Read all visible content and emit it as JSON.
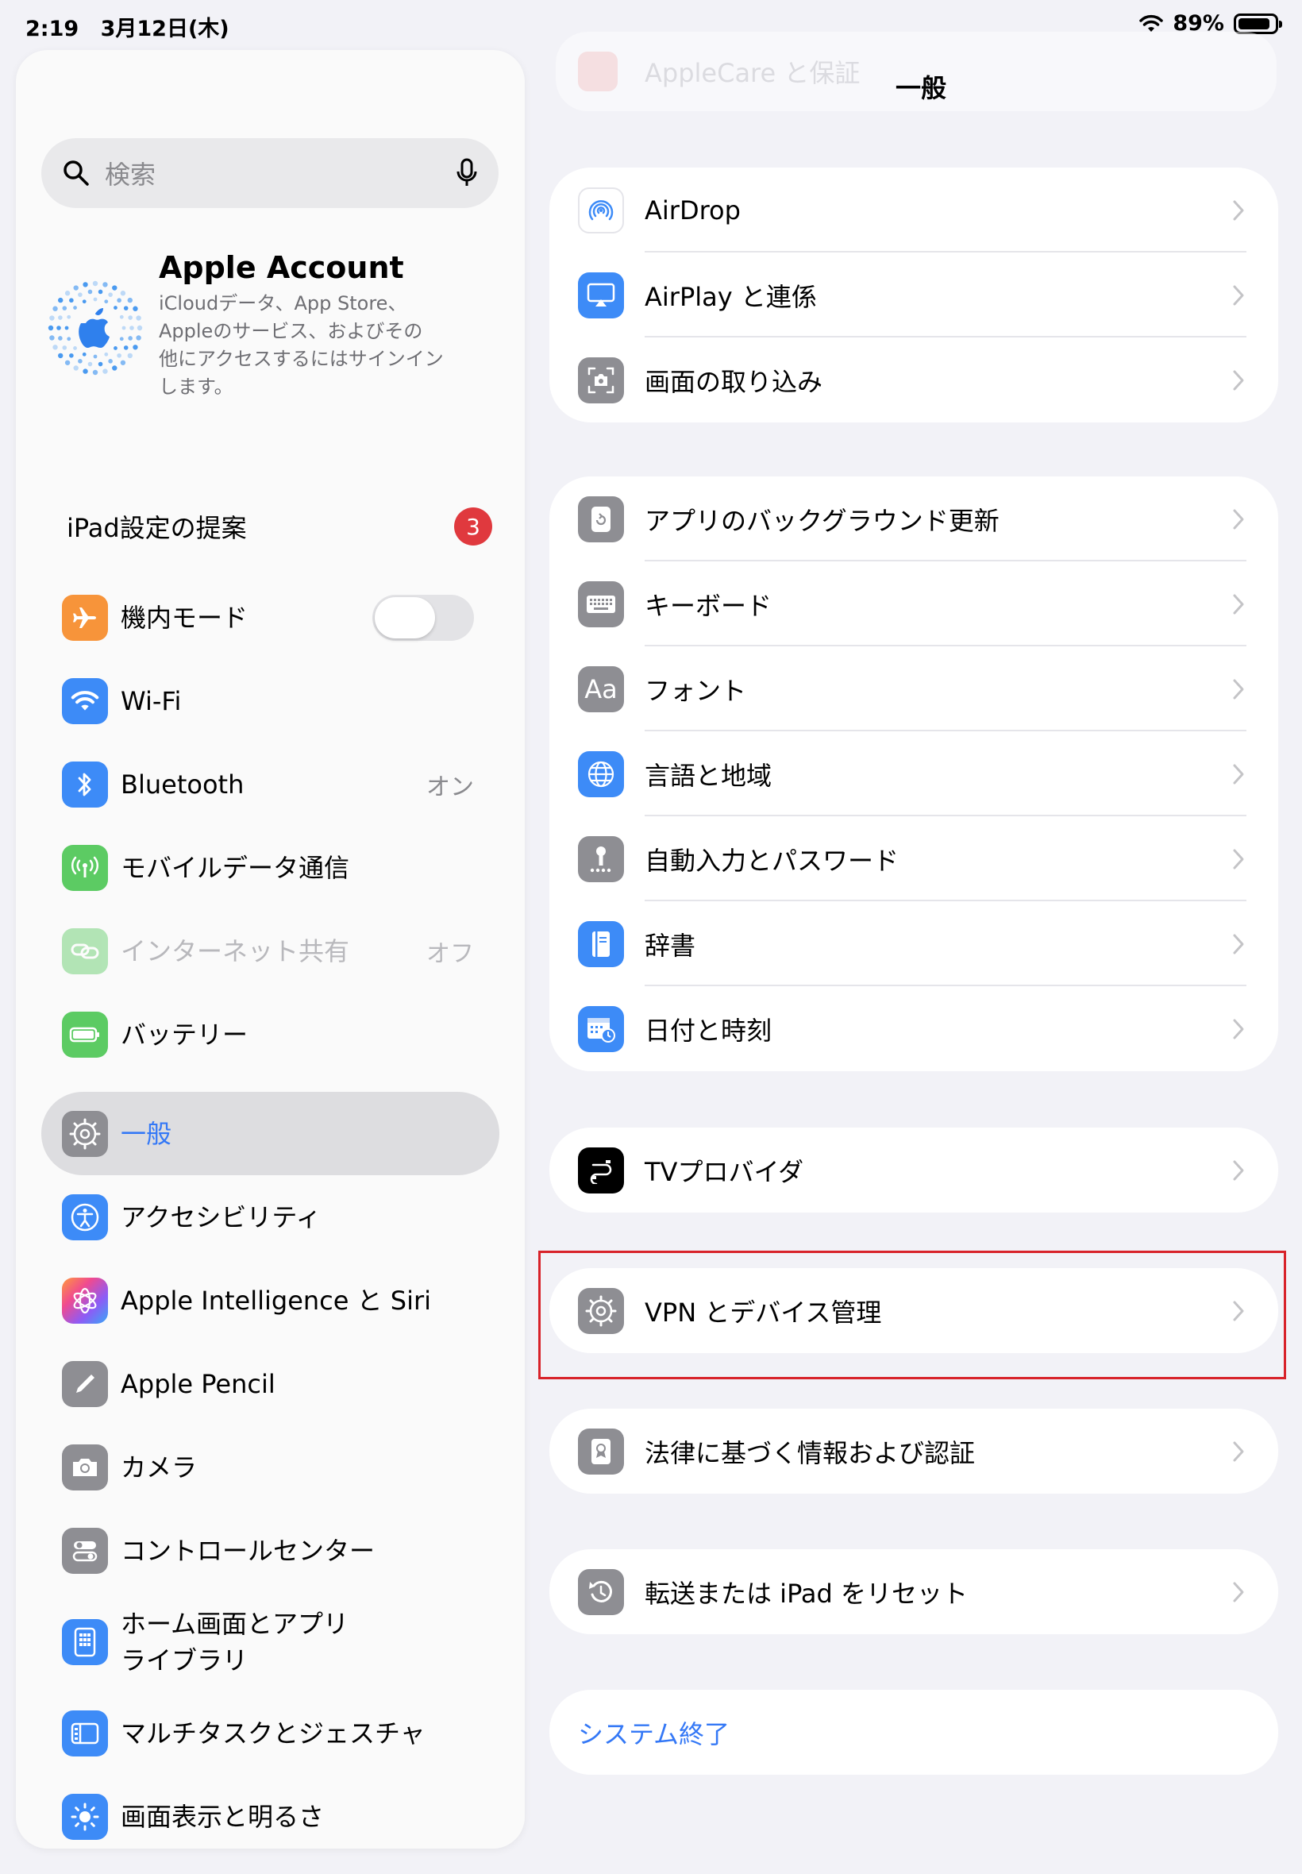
{
  "status_bar": {
    "time": "2:19",
    "date": "3月12日(木)",
    "battery_percent": "89%",
    "battery_level": 0.89
  },
  "sidebar": {
    "search_placeholder": "検索",
    "account": {
      "title": "Apple Account",
      "subtitle_lines": [
        "iCloudデータ、App Store、",
        "Appleのサービス、およびその",
        "他にアクセスするにはサインイン",
        "します。"
      ]
    },
    "suggestions": {
      "label": "iPad設定の提案",
      "badge": "3"
    },
    "items": [
      {
        "label": "機内モード",
        "toggle_on": false
      },
      {
        "label": "Wi-Fi",
        "value": ""
      },
      {
        "label": "Bluetooth",
        "value": "オン"
      },
      {
        "label": "モバイルデータ通信",
        "value": ""
      },
      {
        "label": "インターネット共有",
        "value": "オフ"
      },
      {
        "label": "バッテリー",
        "value": ""
      },
      {
        "label": "一般",
        "selected": true
      },
      {
        "label": "アクセシビリティ"
      },
      {
        "label": "Apple Intelligence と Siri"
      },
      {
        "label": "Apple Pencil"
      },
      {
        "label": "カメラ"
      },
      {
        "label": "コントロールセンター"
      },
      {
        "label_lines": [
          "ホーム画面とアプリ",
          "ライブラリ"
        ]
      },
      {
        "label": "マルチタスクとジェスチャ"
      },
      {
        "label": "画面表示と明るさ"
      }
    ]
  },
  "main": {
    "title": "一般",
    "ghost_row_label": "AppleCare と保証",
    "groups": [
      {
        "rows": [
          {
            "label": "AirDrop",
            "icon": "airdrop-icon"
          },
          {
            "label": "AirPlay と連係",
            "icon": "airplay-icon"
          },
          {
            "label": "画面の取り込み",
            "icon": "screen-capture-icon"
          }
        ]
      },
      {
        "rows": [
          {
            "label": "アプリのバックグラウンド更新",
            "icon": "background-refresh-icon"
          },
          {
            "label": "キーボード",
            "icon": "keyboard-icon"
          },
          {
            "label": "フォント",
            "icon": "fonts-icon",
            "glyph": "Aa"
          },
          {
            "label": "言語と地域",
            "icon": "globe-icon"
          },
          {
            "label": "自動入力とパスワード",
            "icon": "key-icon"
          },
          {
            "label": "辞書",
            "icon": "dictionary-icon"
          },
          {
            "label": "日付と時刻",
            "icon": "calendar-clock-icon"
          }
        ]
      },
      {
        "rows": [
          {
            "label": "TVプロバイダ",
            "icon": "tv-provider-icon"
          }
        ]
      },
      {
        "rows": [
          {
            "label": "VPN とデバイス管理",
            "icon": "gear-icon"
          }
        ]
      },
      {
        "rows": [
          {
            "label": "法律に基づく情報および認証",
            "icon": "legal-icon"
          }
        ]
      },
      {
        "rows": [
          {
            "label": "転送または iPad をリセット",
            "icon": "reset-icon"
          }
        ]
      }
    ],
    "shutdown_label": "システム終了"
  },
  "colors": {
    "accent": "#3478F6",
    "badge": "#E0393E",
    "highlight_box": "#D8232A",
    "background": "#F2F2F7"
  }
}
